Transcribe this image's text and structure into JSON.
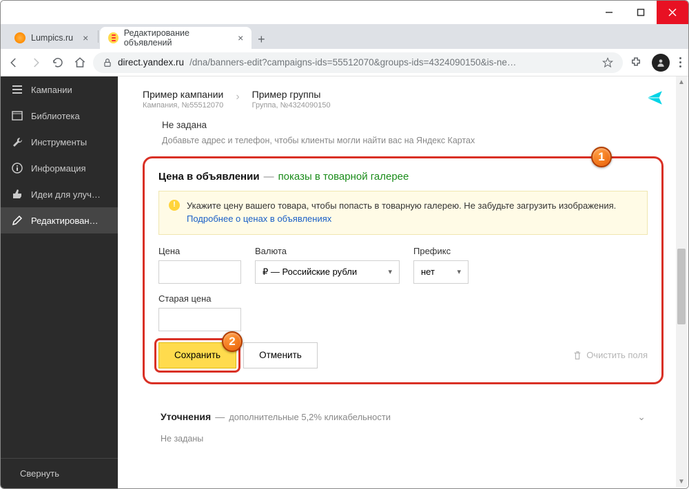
{
  "window": {
    "title": ""
  },
  "tabs": [
    {
      "title": "Lumpics.ru",
      "active": false
    },
    {
      "title": "Редактирование объявлений",
      "active": true
    }
  ],
  "addressbar": {
    "host": "direct.yandex.ru",
    "path": "/dna/banners-edit?campaigns-ids=55512070&groups-ids=4324090150&is-ne…"
  },
  "sidebar": {
    "items": [
      {
        "label": "Кампании",
        "icon": "menu-icon"
      },
      {
        "label": "Библиотека",
        "icon": "book-icon"
      },
      {
        "label": "Инструменты",
        "icon": "wrench-icon"
      },
      {
        "label": "Информация",
        "icon": "info-icon"
      },
      {
        "label": "Идеи для улуч…",
        "icon": "thumb-icon"
      },
      {
        "label": "Редактирован…",
        "icon": "pencil-icon",
        "active": true
      }
    ],
    "collapse": "Свернуть"
  },
  "breadcrumb": {
    "campaign_title": "Пример кампании",
    "campaign_sub": "Кампания, №55512070",
    "group_title": "Пример группы",
    "group_sub": "Группа, №4324090150"
  },
  "top_block": {
    "line1": "Не задана",
    "line2": "Добавьте адрес и телефон, чтобы клиенты могли найти вас на Яндекс Картах"
  },
  "price_panel": {
    "title": "Цена в объявлении",
    "gallery_link": "показы в товарной галерее",
    "info_text_1": "Укажите цену вашего товара, чтобы попасть в товарную галерею. Не забудьте загрузить изображения. ",
    "info_link": "Подробнее о ценах в объявлениях",
    "labels": {
      "price": "Цена",
      "currency": "Валюта",
      "prefix": "Префикс",
      "old_price": "Старая цена"
    },
    "currency_value": "₽ — Российские рубли",
    "prefix_value": "нет",
    "save": "Сохранить",
    "cancel": "Отменить",
    "clear": "Очистить поля"
  },
  "bottom_section": {
    "title": "Уточнения",
    "note": "дополнительные 5,2% кликабельности",
    "sub": "Не заданы"
  },
  "callouts": {
    "b1": "1",
    "b2": "2"
  }
}
